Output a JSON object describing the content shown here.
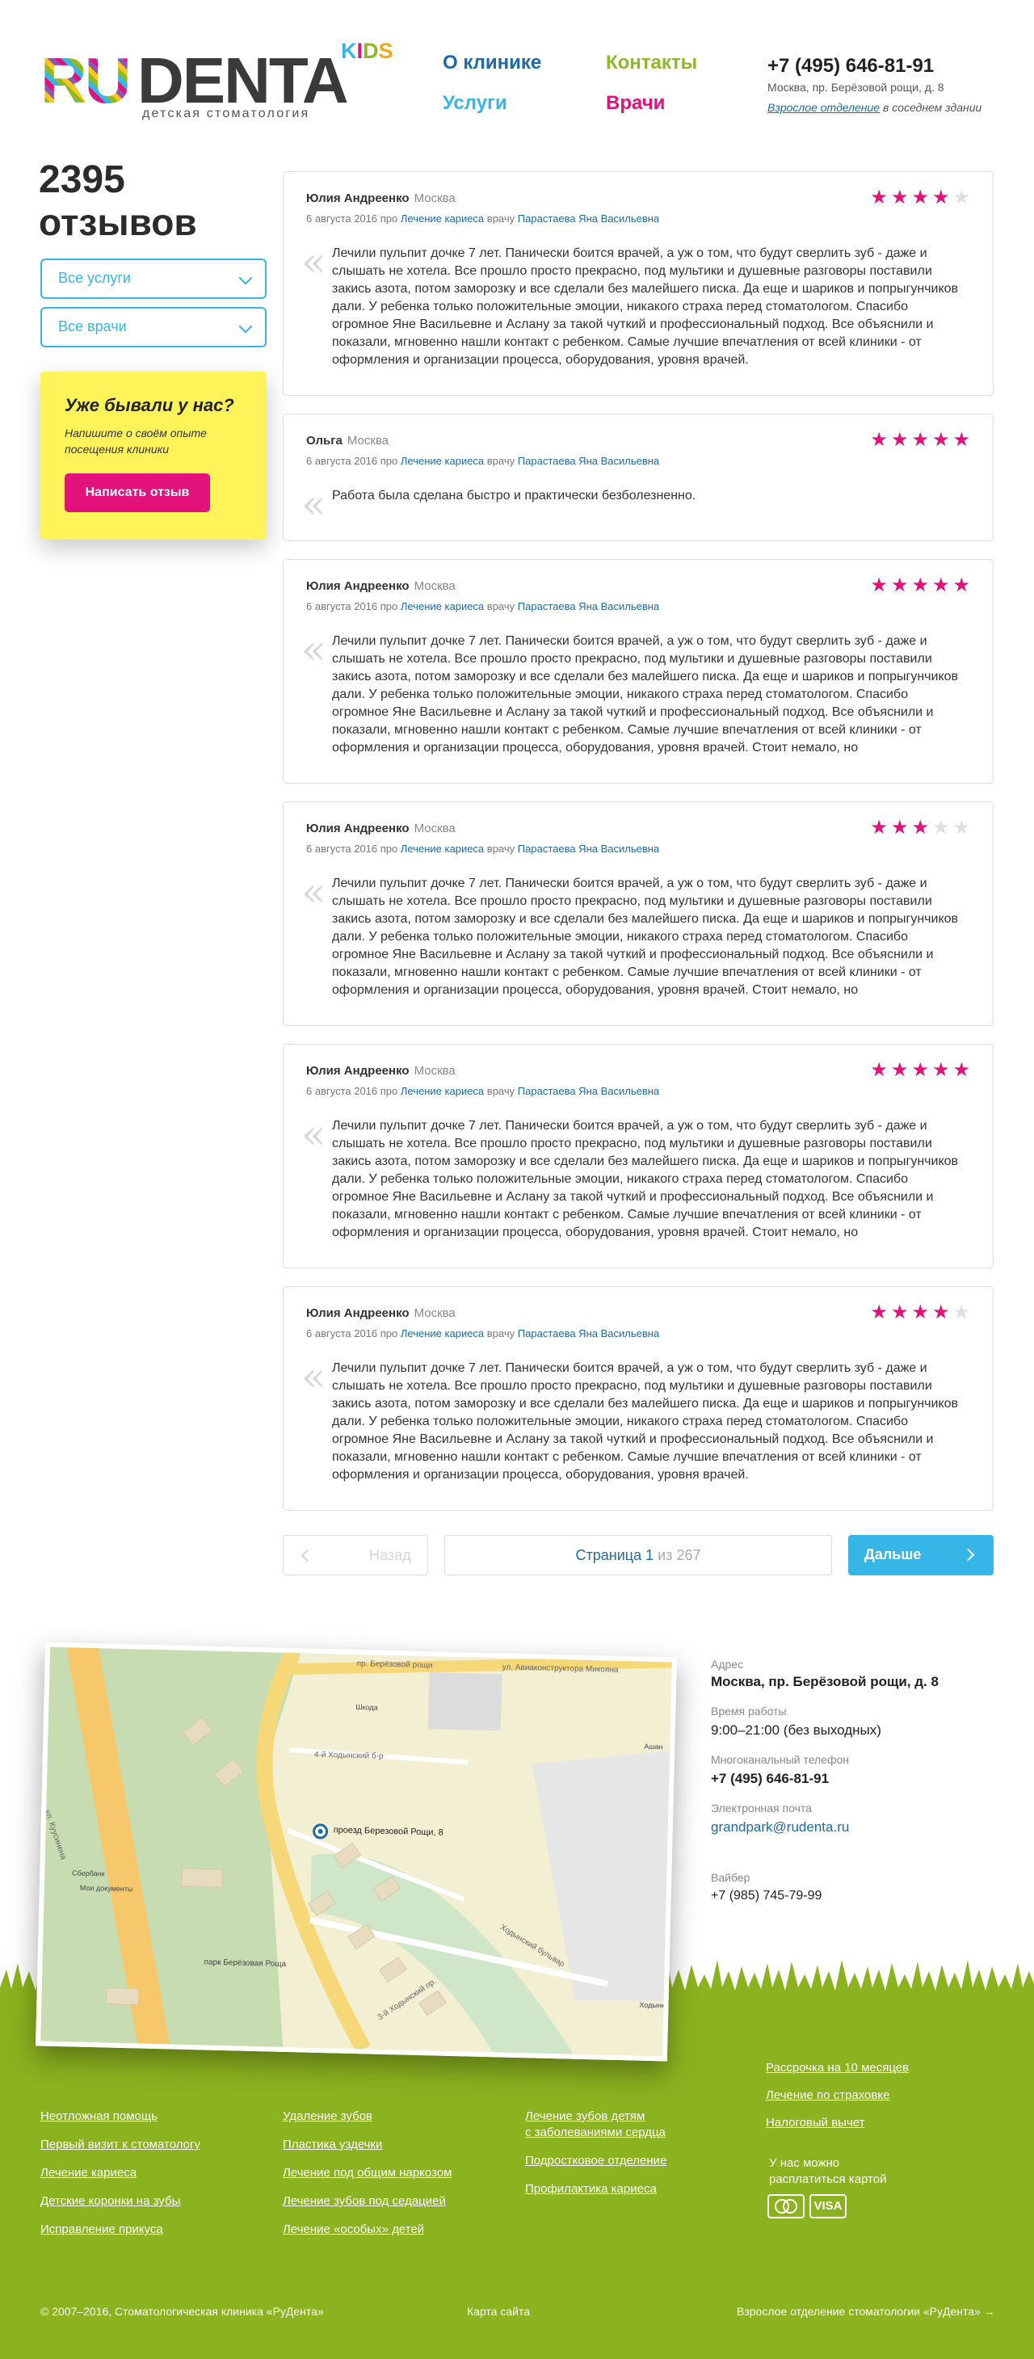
{
  "brand": {
    "ru": "RU",
    "denta": "DENTA",
    "kids": [
      "K",
      "I",
      "D",
      "S"
    ],
    "tagline": "детская стоматология"
  },
  "nav": {
    "about": "О клинике",
    "services": "Услуги",
    "contacts": "Контакты",
    "doctors": "Врачи"
  },
  "header": {
    "phone": "+7 (495) 646-81-91",
    "address": "Москва, пр. Берёзовой рощи, д. 8",
    "adult_link": "Взрослое отделение",
    "adult_suffix": " в соседнем здании"
  },
  "sidebar": {
    "count": "2395",
    "count_word": "отзывов",
    "filter_services": "Все услуги",
    "filter_doctors": "Все врачи",
    "promo_title": "Уже бывали у нас?",
    "promo_text": "Напишите о своём опыте посещения клиники",
    "promo_button": "Написать отзыв"
  },
  "reviews": [
    {
      "author": "Юлия Андреенко",
      "city": "Москва",
      "date": "6 августа 2016 про",
      "service": "Лечение кариеса",
      "doctor_pre": "врачу",
      "doctor": "Парастаева Яна Васильевна",
      "rating": 4,
      "text": "Лечили пульпит дочке 7 лет. Панически боится врачей, а уж о том, что будут сверлить зуб - даже и слышать не хотела. Все прошло просто прекрасно, под мультики и душевные разговоры поставили закись азота, потом заморозку и все сделали без малейшего писка. Да еще и шариков и попрыгунчиков дали. У ребенка только положительные эмоции, никакого страха перед стоматологом. Спасибо огромное Яне Васильевне и Аслану за такой чуткий и профессиональный подход. Все объяснили и показали, мгновенно нашли контакт с ребенком. Самые лучшие впечатления от всей клиники - от оформления и организации процесса, оборудования, уровня врачей."
    },
    {
      "author": "Ольга",
      "city": "Москва",
      "date": "6 августа 2016 про",
      "service": "Лечение кариеса",
      "doctor_pre": "врачу",
      "doctor": "Парастаева Яна Васильевна",
      "rating": 5,
      "text": "Работа была сделана быстро и практически безболезненно."
    },
    {
      "author": "Юлия Андреенко",
      "city": "Москва",
      "date": "6 августа 2016 про",
      "service": "Лечение кариеса",
      "doctor_pre": "врачу",
      "doctor": "Парастаева Яна Васильевна",
      "rating": 5,
      "text": "Лечили пульпит дочке 7 лет. Панически боится врачей, а уж о том, что будут сверлить зуб - даже и слышать не хотела. Все прошло просто прекрасно, под мультики и душевные разговоры поставили закись азота, потом заморозку и все сделали без малейшего писка. Да еще и шариков и попрыгунчиков дали. У ребенка только положительные эмоции, никакого страха перед стоматологом. Спасибо огромное Яне Васильевне и Аслану за такой чуткий и профессиональный подход. Все объяснили и показали, мгновенно нашли контакт с ребенком. Самые лучшие впечатления от всей клиники - от оформления и организации процесса, оборудования, уровня врачей. Стоит немало, но"
    },
    {
      "author": "Юлия Андреенко",
      "city": "Москва",
      "date": "6 августа 2016 про",
      "service": "Лечение кариеса",
      "doctor_pre": "врачу",
      "doctor": "Парастаева Яна Васильевна",
      "rating": 3,
      "text": "Лечили пульпит дочке 7 лет. Панически боится врачей, а уж о том, что будут сверлить зуб - даже и слышать не хотела. Все прошло просто прекрасно, под мультики и душевные разговоры поставили закись азота, потом заморозку и все сделали без малейшего писка. Да еще и шариков и попрыгунчиков дали. У ребенка только положительные эмоции, никакого страха перед стоматологом. Спасибо огромное Яне Васильевне и Аслану за такой чуткий и профессиональный подход. Все объяснили и показали, мгновенно нашли контакт с ребенком. Самые лучшие впечатления от всей клиники - от оформления и организации процесса, оборудования, уровня врачей. Стоит немало, но"
    },
    {
      "author": "Юлия Андреенко",
      "city": "Москва",
      "date": "6 августа 2016 про",
      "service": "Лечение кариеса",
      "doctor_pre": "врачу",
      "doctor": "Парастаева Яна Васильевна",
      "rating": 5,
      "text": "Лечили пульпит дочке 7 лет. Панически боится врачей, а уж о том, что будут сверлить зуб - даже и слышать не хотела. Все прошло просто прекрасно, под мультики и душевные разговоры поставили закись азота, потом заморозку и все сделали без малейшего писка. Да еще и шариков и попрыгунчиков дали. У ребенка только положительные эмоции, никакого страха перед стоматологом. Спасибо огромное Яне Васильевне и Аслану за такой чуткий и профессиональный подход. Все объяснили и показали, мгновенно нашли контакт с ребенком. Самые лучшие впечатления от всей клиники - от оформления и организации процесса, оборудования, уровня врачей. Стоит немало, но"
    },
    {
      "author": "Юлия Андреенко",
      "city": "Москва",
      "date": "6 августа 2016 про",
      "service": "Лечение кариеса",
      "doctor_pre": "врачу",
      "doctor": "Парастаева Яна Васильевна",
      "rating": 4,
      "text": "Лечили пульпит дочке 7 лет. Панически боится врачей, а уж о том, что будут сверлить зуб - даже и слышать не хотела. Все прошло просто прекрасно, под мультики и душевные разговоры поставили закись азота, потом заморозку и все сделали без малейшего писка. Да еще и шариков и попрыгунчиков дали. У ребенка только положительные эмоции, никакого страха перед стоматологом. Спасибо огромное Яне Васильевне и Аслану за такой чуткий и профессиональный подход. Все объяснили и показали, мгновенно нашли контакт с ребенком. Самые лучшие впечатления от всей клиники - от оформления и организации процесса, оборудования, уровня врачей."
    }
  ],
  "pager": {
    "prev": "Назад",
    "page_label": "Страница",
    "page": "1",
    "of": "из 267",
    "next": "Дальше"
  },
  "map": {
    "streets": [
      "пр. Берёзовой рощи",
      "ул. Авиаконструктора Микояна",
      "ул. Куусинена",
      "4-й Ходынский б-р",
      "3-й Ходынский пр.",
      "Ходынский бульвар"
    ],
    "pin_label": "проезд Березовой Рощи, 8",
    "park": "парк Берёзовая Роща",
    "pois": [
      "Сбербанк",
      "Мои документы",
      "Шкода",
      "Ашан",
      "Ходынка"
    ]
  },
  "contacts": {
    "addr_label": "Адрес",
    "addr": "Москва, пр. Берёзовой рощи, д. 8",
    "hours_label": "Время работы",
    "hours": "9:00–21:00 (без выходных)",
    "phone_label": "Многоканальный телефон",
    "phone": "+7 (495) 646-81-91",
    "email_label": "Электронная почта",
    "email": "grandpark@rudenta.ru",
    "viber_label": "Вайбер",
    "viber": "+7 (985) 745-79-99"
  },
  "footer": {
    "col1": [
      "Неотложная помощь",
      "Первый визит к стоматологу",
      "Лечение кариеса",
      "Детские коронки на зубы",
      "Исправление прикуса"
    ],
    "col2": [
      "Удаление зубов",
      "Пластика уздечки",
      "Лечение под общим наркозом",
      "Лечение зубов под седацией",
      "Лечение «особых» детей"
    ],
    "col3_a1": "Лечение зубов детям",
    "col3_a2": "с заболеваниями сердца",
    "col3_b": "Подростковое отделение",
    "col3_c": "Профилактика кариеса",
    "col4": [
      "Рассрочка на 10 месяцев",
      "Лечение по страховке",
      "Налоговый вычет"
    ],
    "card_text_1": "У нас можно",
    "card_text_2": "расплатиться картой",
    "visa": "VISA",
    "copyright": "© 2007–2016, Стоматологическая клиника «РуДента»",
    "sitemap": "Карта сайта",
    "adult": "Взрослое отделение стоматологии «РуДента» →"
  },
  "colors": {
    "brand_pink": "#e3127a",
    "brand_blue": "#36b6e6",
    "dark_blue": "#1d6aa8",
    "green": "#8fb826",
    "footer_green": "#8bb21f",
    "promo_yellow": "#fff35a"
  }
}
